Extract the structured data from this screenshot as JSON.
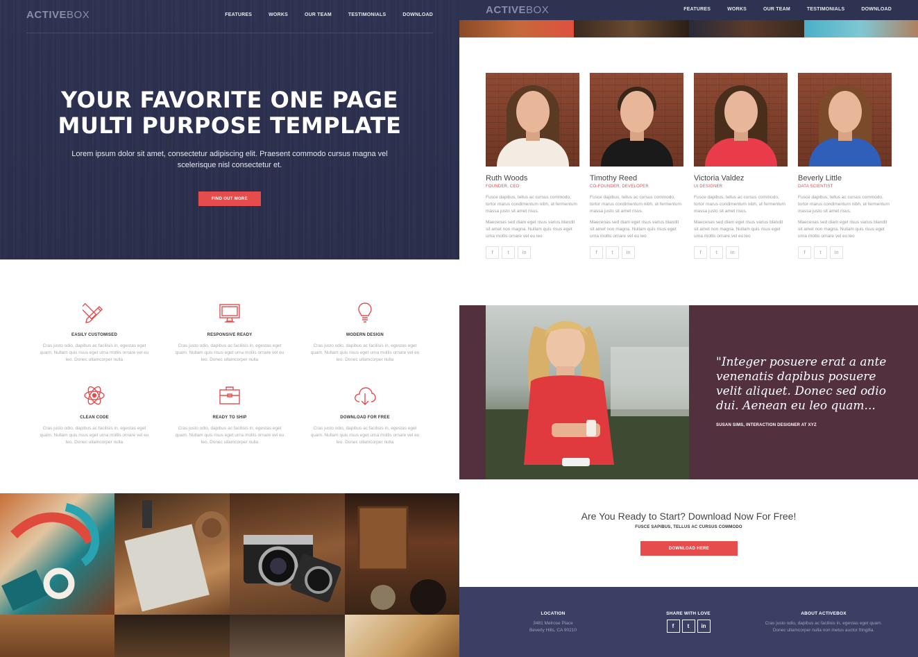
{
  "brand": {
    "logo_bold": "ACTIVE",
    "logo_light": "BOX"
  },
  "nav": {
    "items": [
      "FEATURES",
      "WORKS",
      "OUR TEAM",
      "TESTIMONIALS",
      "DOWNLOAD"
    ]
  },
  "hero": {
    "title_line1": "YOUR FAVORITE ONE PAGE",
    "title_line2": "MULTI PURPOSE TEMPLATE",
    "lead": "Lorem ipsum dolor sit amet, consectetur adipiscing elit. Praesent commodo cursus magna vel scelerisque nisl consectetur et.",
    "button": "FIND OUT MORE"
  },
  "features": [
    {
      "icon": "pencil-ruler-icon",
      "title": "EASILY CUSTOMISED",
      "desc": "Cras justo odio, dapibus ac facilisis in, egestas eget quam. Nullam quis risus eget urna mollis ornare vel eu leo. Donec ullamcorper nulla"
    },
    {
      "icon": "monitor-icon",
      "title": "RESPONSIVE READY",
      "desc": "Cras justo odio, dapibus ac facilisis in, egestas eget quam. Nullam quis risus eget urna mollis ornare vel eu leo. Donec ullamcorper nulla"
    },
    {
      "icon": "lightbulb-icon",
      "title": "MODERN DESIGN",
      "desc": "Cras justo odio, dapibus ac facilisis in, egestas eget quam. Nullam quis risus eget urna mollis ornare vel eu leo. Donec ullamcorper nulla"
    },
    {
      "icon": "atom-icon",
      "title": "CLEAN CODE",
      "desc": "Cras justo odio, dapibus ac facilisis in, egestas eget quam. Nullam quis risus eget urna mollis ornare vel eu leo. Donec ullamcorper nulla"
    },
    {
      "icon": "briefcase-icon",
      "title": "READY TO SHIP",
      "desc": "Cras justo odio, dapibus ac facilisis in, egestas eget quam. Nullam quis risus eget urna mollis ornare vel eu leo. Donec ullamcorper nulla"
    },
    {
      "icon": "cloud-download-icon",
      "title": "DOWNLOAD FOR FREE",
      "desc": "Cras justo odio, dapibus ac facilisis in, egestas eget quam. Nullam quis risus eget urna mollis ornare vel eu leo. Donec ullamcorper nulla"
    }
  ],
  "team": [
    {
      "name": "Ruth Woods",
      "role": "FOUNDER, CEO",
      "text1": "Fusce dapibus, tellus ac cursus commodo, tortor marus condimentum nibh, ut fermentum massa justo sit amet risus.",
      "text2": "Maecenas sed diam eget risus varius blandit sit amet non magna. Nullam quis risus eget urna mollis ornare vel eu leo"
    },
    {
      "name": "Timothy Reed",
      "role": "CO-FOUNDER, DEVELOPER",
      "text1": "Fusce dapibus, tellus ac cursus commodo, tortor marus condimentum nibh, ut fermentum massa justo sit amet risus.",
      "text2": "Maecenas sed diam eget risus varius blandit sit amet non magna. Nullam quis risus eget urna mollis ornare vel eu leo"
    },
    {
      "name": "Victoria Valdez",
      "role": "UI DESIGNER",
      "text1": "Fusce dapibus, tellus ac cursus commodo, tortor marus condimentum nibh, ut fermentum massa justo sit amet risus.",
      "text2": "Maecenas sed diam eget risus varius blandit sit amet non magna. Nullam quis risus eget urna mollis ornare vel eu leo"
    },
    {
      "name": "Beverly Little",
      "role": "DATA SCIENTIST",
      "text1": "Fusce dapibus, tellus ac cursus commodo, tortor marus condimentum nibh, ut fermentum massa justo sit amet risus.",
      "text2": "Maecenas sed diam eget risus varius blandit sit amet non magna. Nullam quis risus eget urna mollis ornare vel eu leo"
    }
  ],
  "social_icons": {
    "facebook": "f",
    "twitter": "t",
    "linkedin": "in"
  },
  "testimonial": {
    "quote": "\"Integer posuere erat a ante venenatis dapibus posuere velit aliquet. Donec sed odio dui. Aenean eu leo quam...",
    "author": "SUSAN SIMS, INTERACTION DESIGNER AT XYZ"
  },
  "cta": {
    "title": "Are You Ready to Start? Download Now For Free!",
    "subtitle": "FUSCE SAPIBUS, TELLUS AC CURSUS COMMODO",
    "button": "DOWNLOAD HERE"
  },
  "footer": {
    "location_title": "LOCATION",
    "location_line1": "3481 Melrose Place",
    "location_line2": "Beverly Hills, CA 90210",
    "share_title": "SHARE WITH LOVE",
    "about_title": "ABOUT ACTIVEBOX",
    "about_text": "Cras justo odio, dapibus ac facilisis in, egestas eget quam. Donec ullamcorper nulla non metus auctor fringilla."
  },
  "colors": {
    "navy": "#2e3352",
    "accent_red": "#e74c4c",
    "testimonial_bg": "#52303e",
    "footer_bg": "#3b3f63"
  }
}
